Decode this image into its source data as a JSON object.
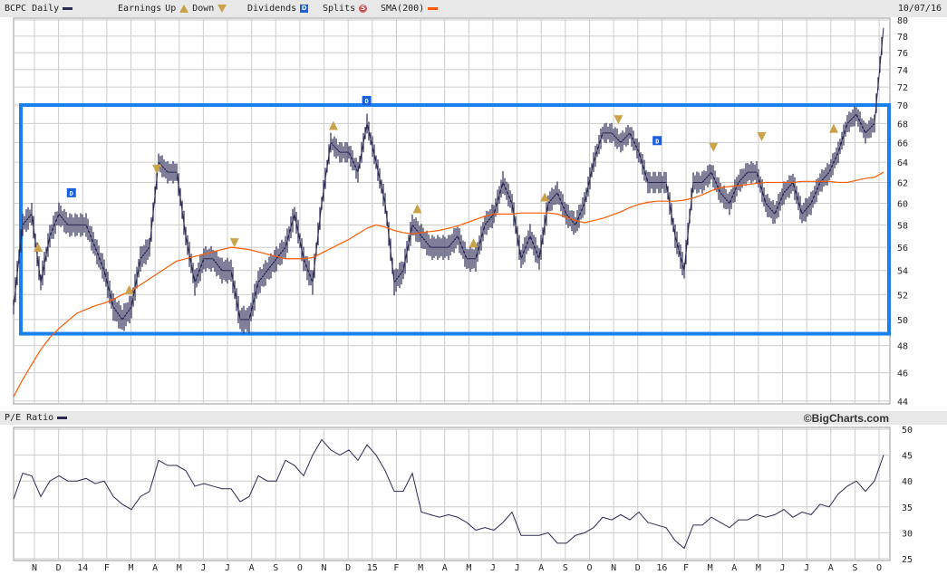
{
  "header": {
    "ticker_label": "BCPC Daily",
    "earnings_label": "Earnings",
    "up_label": "Up",
    "down_label": "Down",
    "dividends_label": "Dividends",
    "splits_label": "Splits",
    "sma_label": "SMA(200)",
    "date": "10/07/16",
    "dividend_glyph": "D",
    "split_glyph": "S",
    "earnings_glyph": "E"
  },
  "lower_header": {
    "title": "P/E Ratio",
    "brand": "©BigCharts.com"
  },
  "colors": {
    "price": "#2a2a55",
    "sma": "#ff5a00",
    "box": "#1a80ee",
    "earnings": "#c9a24a",
    "dividend": "#1a5fe0",
    "split": "#cc5555",
    "grid": "#cccccc"
  },
  "chart_data": [
    {
      "type": "line",
      "title": "BCPC Daily",
      "scale": "log",
      "ylim": [
        44,
        80
      ],
      "yticks": [
        44,
        46,
        48,
        50,
        52,
        54,
        56,
        58,
        60,
        62,
        64,
        66,
        68,
        70,
        72,
        74,
        76,
        78,
        80
      ],
      "x_start": "2013-10-04",
      "x_end": "2016-10-07",
      "xticks": [
        "N",
        "D",
        "14",
        "F",
        "M",
        "A",
        "M",
        "J",
        "J",
        "A",
        "S",
        "O",
        "N",
        "D",
        "15",
        "F",
        "M",
        "A",
        "M",
        "J",
        "J",
        "A",
        "S",
        "O",
        "N",
        "D",
        "16",
        "F",
        "M",
        "A",
        "M",
        "J",
        "J",
        "A",
        "S",
        "O"
      ],
      "series": [
        {
          "name": "BCPC Daily",
          "values": [
            51,
            58,
            59,
            53,
            57,
            59,
            58,
            58,
            58,
            56,
            54,
            51,
            50,
            51,
            55,
            56,
            64,
            63,
            63,
            57,
            53,
            55,
            55,
            54,
            54,
            50,
            50,
            53,
            54,
            55,
            56,
            59,
            55,
            53,
            60,
            66,
            65,
            65,
            63,
            68,
            64,
            60,
            53,
            54,
            58,
            57,
            56,
            56,
            56,
            57,
            55,
            55,
            58,
            59,
            62,
            60,
            55,
            57,
            55,
            60,
            61,
            59,
            58,
            60,
            64,
            67,
            67,
            66,
            67,
            65,
            62,
            62,
            62,
            57,
            54,
            62,
            62,
            63,
            61,
            60,
            62,
            63,
            63,
            60,
            59,
            61,
            62,
            59,
            60,
            62,
            63,
            65,
            68,
            69,
            67,
            68,
            79
          ]
        },
        {
          "name": "SMA(200)",
          "values": [
            44.3,
            45.5,
            46.6,
            47.7,
            48.6,
            49.3,
            49.9,
            50.5,
            50.8,
            51.1,
            51.3,
            51.6,
            52,
            52.3,
            52.8,
            53.3,
            53.8,
            54.3,
            54.8,
            55,
            55.2,
            55.4,
            55.6,
            55.8,
            56,
            55.9,
            55.8,
            55.6,
            55.4,
            55.2,
            55,
            55,
            55,
            55.1,
            55.5,
            55.9,
            56.3,
            56.7,
            57.2,
            57.7,
            58,
            57.8,
            57.5,
            57.3,
            57.2,
            57.3,
            57.4,
            57.5,
            57.7,
            57.9,
            58.2,
            58.5,
            58.8,
            59,
            59,
            59,
            59.1,
            59.1,
            59.1,
            59.1,
            59,
            58.7,
            58.4,
            58.2,
            58.4,
            58.6,
            58.9,
            59.2,
            59.6,
            59.9,
            60.1,
            60.2,
            60.2,
            60.2,
            60.3,
            60.5,
            60.8,
            61.2,
            61.5,
            61.6,
            61.7,
            61.8,
            61.9,
            62,
            62,
            62,
            62,
            62.1,
            62.1,
            62.1,
            62.1,
            62,
            62,
            62.2,
            62.4,
            62.5,
            63
          ]
        }
      ],
      "events": {
        "earnings_up": [
          {
            "date": "2013-11-04",
            "value": 56.0
          },
          {
            "date": "2014-02-27",
            "value": 52.4
          },
          {
            "date": "2014-11-12",
            "value": 67.8
          },
          {
            "date": "2015-02-26",
            "value": 59.5
          },
          {
            "date": "2015-05-08",
            "value": 56.4
          },
          {
            "date": "2015-08-06",
            "value": 60.6
          },
          {
            "date": "2016-08-05",
            "value": 67.5
          }
        ],
        "earnings_down": [
          {
            "date": "2014-04-03",
            "value": 63.3
          },
          {
            "date": "2014-07-10",
            "value": 56.4
          },
          {
            "date": "2015-11-07",
            "value": 68.4
          },
          {
            "date": "2016-03-06",
            "value": 65.5
          },
          {
            "date": "2016-05-06",
            "value": 66.6
          }
        ],
        "dividends": [
          {
            "date": "2013-12-16",
            "value": 61.0
          },
          {
            "date": "2014-12-24",
            "value": 70.5
          },
          {
            "date": "2015-12-26",
            "value": 66.2
          }
        ]
      },
      "annotation": {
        "type": "rectangle",
        "low": 48.9,
        "high": 70
      }
    },
    {
      "type": "line",
      "title": "P/E Ratio",
      "scale": "linear",
      "ylim": [
        25,
        50
      ],
      "yticks": [
        25,
        30,
        35,
        40,
        45,
        50
      ],
      "x_start": "2013-10-04",
      "x_end": "2016-10-07",
      "series": [
        {
          "name": "P/E Ratio",
          "values": [
            36.5,
            41.5,
            41,
            37,
            40,
            41,
            40,
            40,
            40.5,
            39.5,
            40,
            37,
            35.5,
            34.5,
            37,
            38,
            44,
            43,
            43,
            42,
            39,
            39.5,
            39,
            38.5,
            38.5,
            36,
            37,
            41,
            40,
            40,
            44,
            43,
            41,
            45,
            48,
            46,
            45,
            46,
            44,
            47,
            45,
            42,
            38,
            38,
            41.5,
            34,
            33.5,
            33,
            33.5,
            33,
            32,
            30.5,
            31,
            30.5,
            32,
            34,
            29.5,
            29.5,
            29.5,
            30,
            28,
            28,
            29.5,
            30,
            31,
            33,
            32.5,
            33.5,
            32.5,
            34,
            32,
            31.5,
            31,
            28.5,
            27,
            31.5,
            31.5,
            33,
            32,
            31,
            32.5,
            32.5,
            33.5,
            33,
            33.5,
            34.5,
            33,
            34,
            33.5,
            35.5,
            35,
            37.5,
            39,
            40,
            38,
            40,
            45
          ]
        }
      ]
    }
  ]
}
